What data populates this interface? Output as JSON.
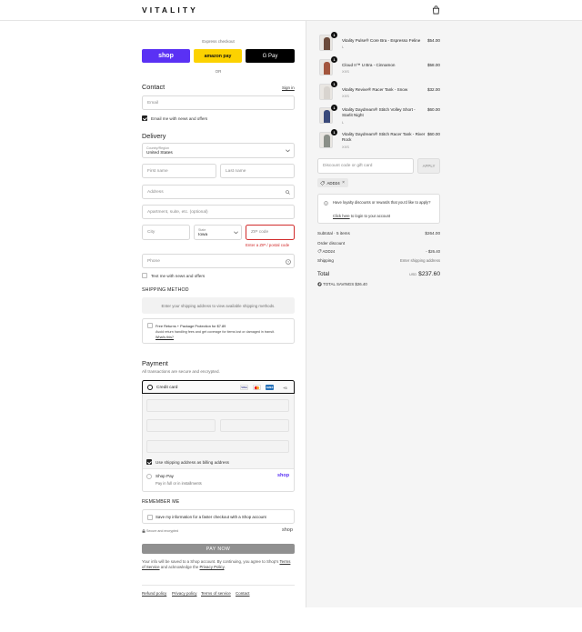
{
  "brand": {
    "logo": "VITALITY",
    "accent": "#5a31f4"
  },
  "express": {
    "label": "Express checkout",
    "shop_pay": "shop",
    "amazon_pay": "amazon pay",
    "google_pay": "G Pay",
    "or": "OR"
  },
  "contact": {
    "title": "Contact",
    "sign_in": "Sign in",
    "email_placeholder": "Email",
    "email_news": "Email me with news and offers",
    "email_news_checked": true
  },
  "delivery": {
    "title": "Delivery",
    "country_label": "Country/Region",
    "country_value": "United States",
    "first_name": "First name",
    "last_name": "Last name",
    "address": "Address",
    "apartment": "Apartment, suite, etc. (optional)",
    "city": "City",
    "state_label": "State",
    "state_value": "Iowa",
    "zip": "ZIP code",
    "zip_error": "Enter a ZIP / postal code",
    "phone": "Phone",
    "text_news": "Text me with news and offers"
  },
  "shipping_method": {
    "title": "SHIPPING METHOD",
    "notice": "Enter your shipping address to view available shipping methods.",
    "protection_title": "Free Returns + Package Protection for $7.89",
    "protection_desc": "Avoid return handling fees and get coverage for items lost or damaged in transit.",
    "protection_link": "What's this?"
  },
  "payment": {
    "title": "Payment",
    "subtitle": "All transactions are secure and encrypted.",
    "credit_card": "Credit card",
    "card_icons": [
      "VISA",
      "MC",
      "AMEX"
    ],
    "more_cards": "+5",
    "billing_same": "Use shipping address as billing address",
    "shop_pay_title": "Shop Pay",
    "shop_pay_desc": "Pay in full or in installments",
    "shop_pay_logo": "shop"
  },
  "remember": {
    "title": "REMEMBER ME",
    "save_info": "Save my information for a faster checkout with a Shop account",
    "secure": "Secure and encrypted",
    "shop_logo": "shop"
  },
  "pay_now": "PAY NOW",
  "legal": {
    "prefix": "Your info will be saved to a Shop account. By continuing, you agree to Shop's",
    "terms": "Terms of Service",
    "middle": "and acknowledge the",
    "privacy": "Privacy Policy",
    "suffix": "."
  },
  "footer_links": [
    "Refund policy",
    "Privacy policy",
    "Terms of service",
    "Contact"
  ],
  "cart": {
    "items": [
      {
        "qty": "1",
        "name": "Vitality Pulse® Core Bra - Espresso Feline",
        "variant": "L",
        "price": "$54.00",
        "color": "#6b4a3a"
      },
      {
        "qty": "1",
        "name": "Cloud II™ U Bra - Cinnamon",
        "variant": "XXS",
        "price": "$58.00",
        "color": "#a3553c"
      },
      {
        "qty": "1",
        "name": "Vitality Revive® Racer Tank - Snow",
        "variant": "XXS",
        "price": "$32.00",
        "color": "#d8d4cf"
      },
      {
        "qty": "1",
        "name": "Vitality Daydream® Stitch Volley Short - Starlit Night",
        "variant": "L",
        "price": "$60.00",
        "color": "#3b4a7a"
      },
      {
        "qty": "1",
        "name": "Vitality Daydream® Stitch Racer Tank - River Rock",
        "variant": "XXS",
        "price": "$60.00",
        "color": "#8a8f88"
      }
    ],
    "discount_placeholder": "Discount code or gift card",
    "apply": "APPLY",
    "applied_code": "ADD24",
    "loyalty_text": "Have loyalty discounts or rewards that you'd like to apply?",
    "loyalty_link": "Click here",
    "loyalty_suffix": "to login to your account",
    "subtotal_label": "Subtotal · 5 items",
    "subtotal_value": "$264.00",
    "order_discount_label": "Order discount",
    "discount_code": "ADD24",
    "discount_value": "- $26.40",
    "shipping_label": "Shipping",
    "shipping_value": "Enter shipping address",
    "total_label": "Total",
    "currency": "USD",
    "total_value": "$237.60",
    "savings_label": "TOTAL SAVINGS",
    "savings_value": "$26.40"
  }
}
